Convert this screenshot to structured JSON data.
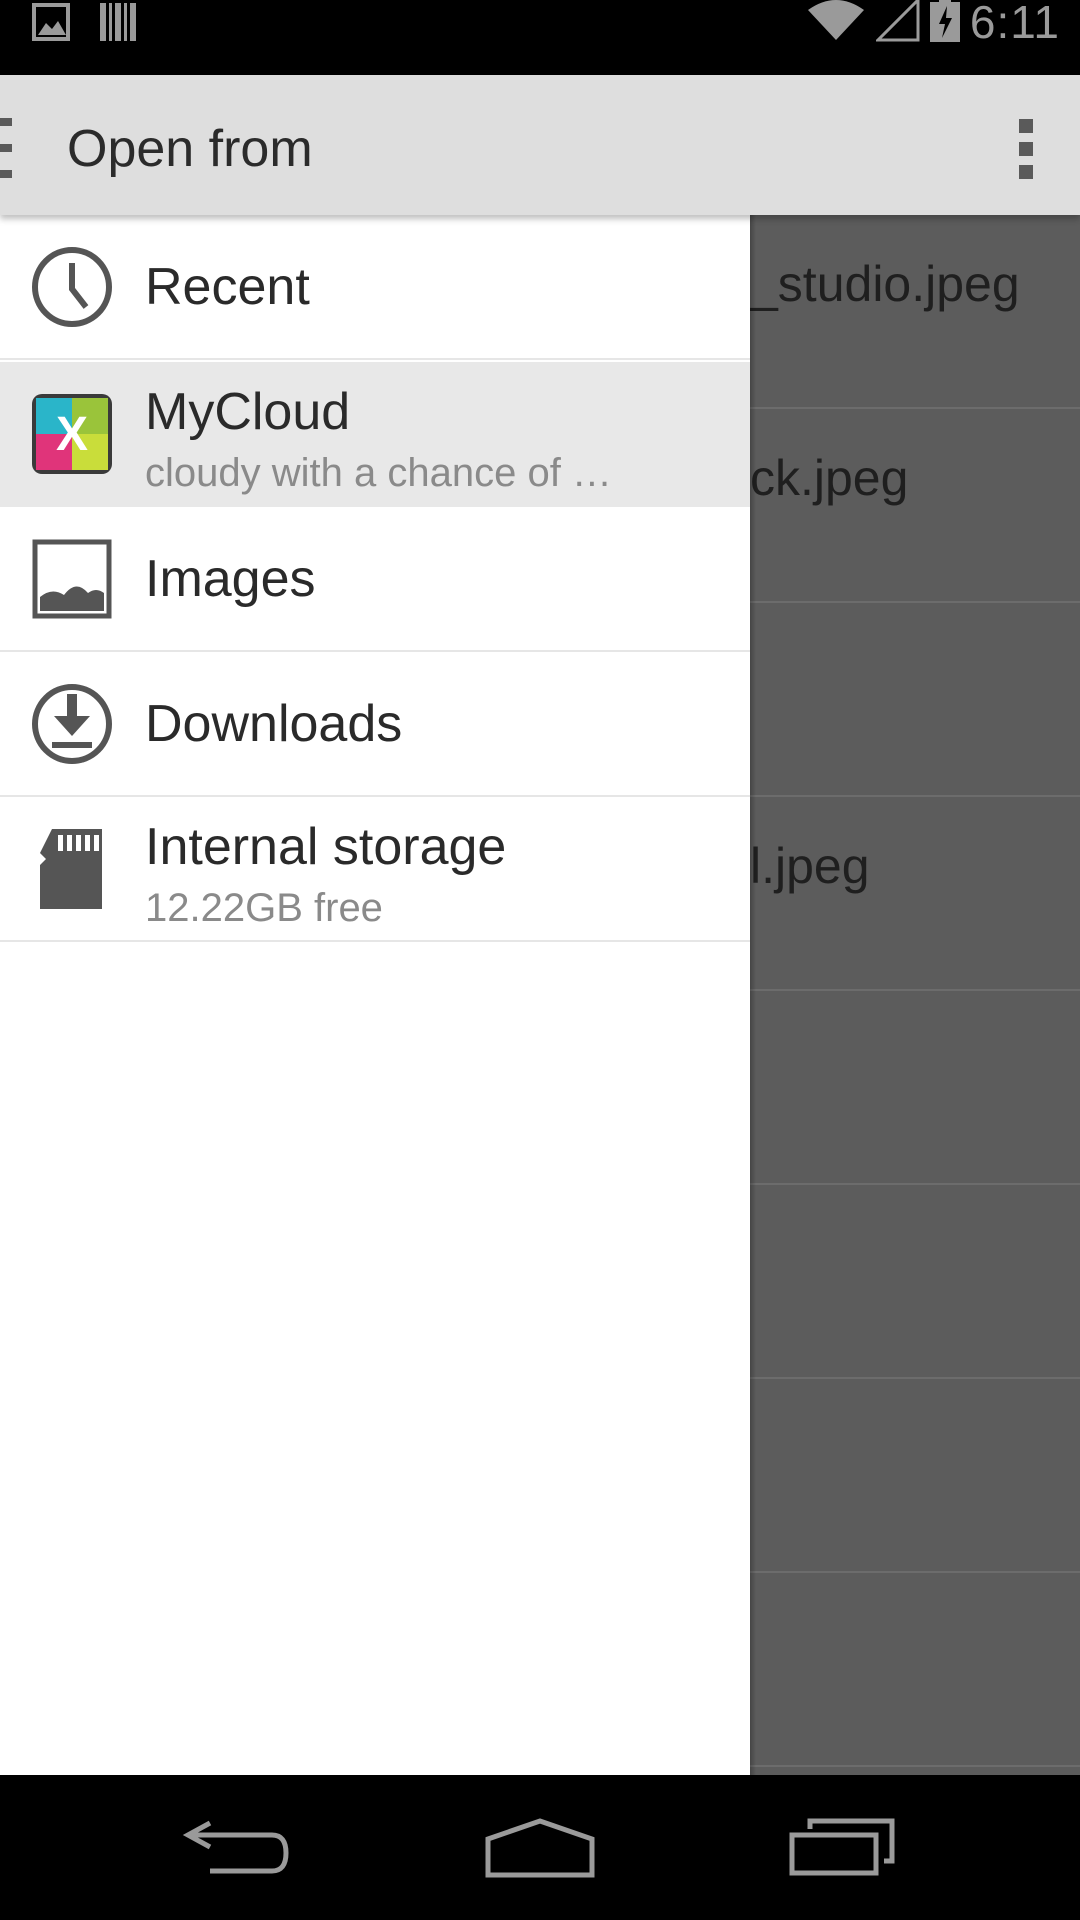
{
  "status_bar": {
    "time": "6:11",
    "icons": [
      "image-notification-icon",
      "barcode-notification-icon",
      "wifi-icon",
      "signal-icon",
      "battery-charging-icon"
    ]
  },
  "app_bar": {
    "title": "Open from",
    "overflow_icon": "more-vert-icon"
  },
  "drawer": {
    "items": [
      {
        "label": "Recent",
        "sublabel": "",
        "icon": "clock-icon"
      },
      {
        "label": "MyCloud",
        "sublabel": "cloudy with a chance of …",
        "icon": "mycloud-app-icon",
        "selected": true
      },
      {
        "label": "Images",
        "sublabel": "",
        "icon": "image-icon"
      },
      {
        "label": "Downloads",
        "sublabel": "",
        "icon": "download-icon"
      },
      {
        "label": "Internal storage",
        "sublabel": "12.22GB free",
        "icon": "sd-card-icon"
      }
    ]
  },
  "background_files": [
    "_studio.jpeg",
    "ck.jpeg",
    "",
    "l.jpeg",
    "",
    "",
    "",
    ""
  ],
  "nav_bar": {
    "buttons": [
      "back-icon",
      "home-icon",
      "recents-icon"
    ]
  },
  "colors": {
    "app_bar_bg": "#dedede",
    "drawer_bg": "#ffffff",
    "selected_item_bg": "#e8e8e8",
    "scrim": "#5c5c5c"
  }
}
